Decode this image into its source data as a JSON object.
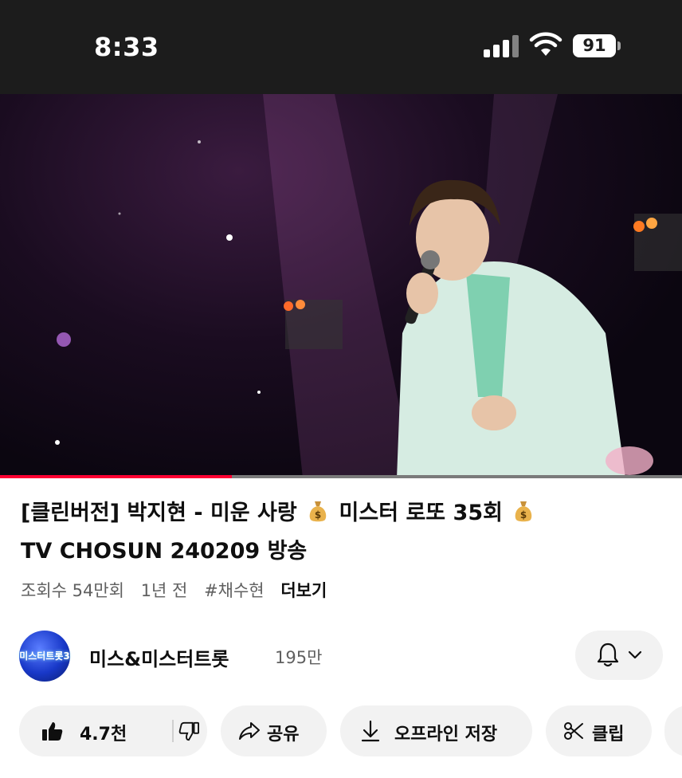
{
  "status_bar": {
    "time": "8:33",
    "battery": "91",
    "icons": [
      "cellular-signal-icon",
      "wifi-icon",
      "battery-icon"
    ]
  },
  "video": {
    "progress_fraction": 0.34,
    "progress_color": "#ff0033"
  },
  "title": {
    "part1": "[클린버전] 박지현 - 미운 사랑",
    "part2": "미스터 로또 35회",
    "part3": "TV CHOSUN 240209 방송",
    "emoji_icon": "money-bag-icon"
  },
  "meta": {
    "views": "조회수 54만회",
    "age": "1년 전",
    "hashtag": "#채수현",
    "more": "더보기"
  },
  "channel": {
    "name": "미스&미스터트롯",
    "subscribers": "195만",
    "avatar_text": "미스터트롯3"
  },
  "actions": {
    "likes": "4.7천",
    "share": "공유",
    "download": "오프라인 저장",
    "clip": "클립"
  },
  "colors": {
    "pill_bg": "#f2f2f2",
    "text_primary": "#0f0f0f",
    "text_secondary": "#606060"
  }
}
